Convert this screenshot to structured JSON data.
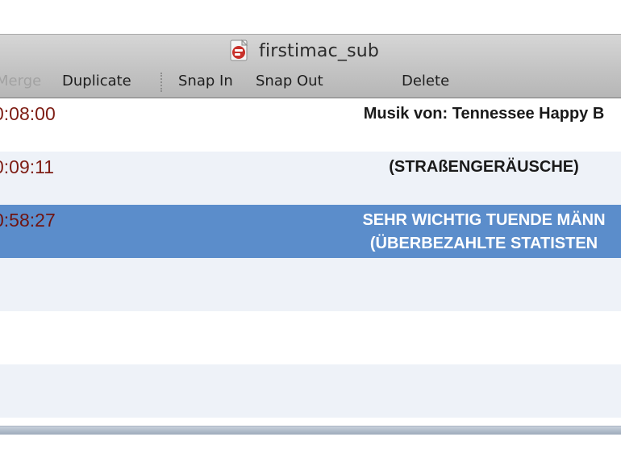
{
  "window": {
    "title": "firstimac_sub",
    "icon": "subtitle-document-icon"
  },
  "toolbar": {
    "merge_label": "Merge",
    "duplicate_label": "Duplicate",
    "snap_in_label": "Snap In",
    "snap_out_label": "Snap Out",
    "delete_label": "Delete"
  },
  "subtitles": [
    {
      "time": "0:08:00",
      "lines": [
        "Musik von: Tennessee Happy B"
      ],
      "selected": false
    },
    {
      "time": "0:09:11",
      "lines": [
        "(STRAßENGERÄUSCHE)"
      ],
      "selected": false
    },
    {
      "time": "0:58:27",
      "lines": [
        "SEHR WICHTIG TUENDE MÄNN",
        "(ÜBERBEZAHLTE STATISTEN"
      ],
      "selected": true
    }
  ],
  "colors": {
    "selection": "#5b8dcb",
    "timecode": "#7e1d14",
    "stripe": "#eef2f8"
  }
}
